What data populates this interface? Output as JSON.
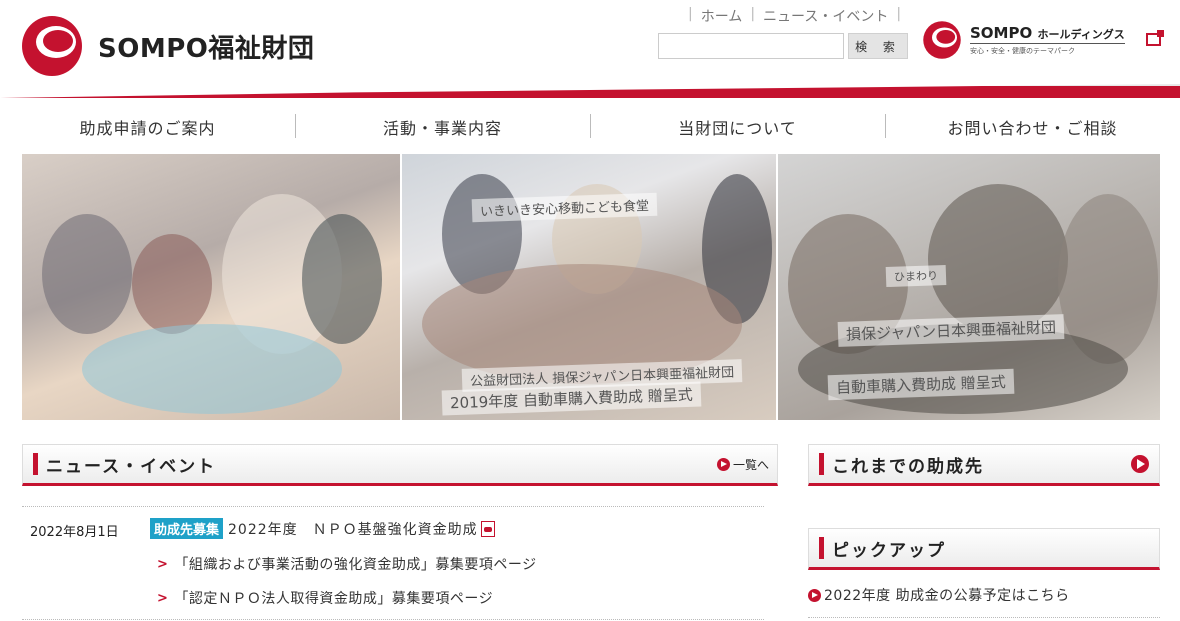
{
  "header": {
    "logo_text": "SOMPO福祉財団",
    "top_links": [
      "ホーム",
      "ニュース・イベント"
    ],
    "search_button": "検 索",
    "search_placeholder": "",
    "holdings_name": "SOMPO",
    "holdings_suffix": "ホールディングス",
    "holdings_tagline": "安心・安全・健康のテーマパーク"
  },
  "nav": {
    "items": [
      "助成申請のご案内",
      "活動・事業内容",
      "当財団について",
      "お問い合わせ・ご相談"
    ]
  },
  "hero": {
    "photo2_banner_top": "いきいき安心移動こども食堂",
    "photo2_banner_1": "公益財団法人 損保ジャパン日本興亜福祉財団",
    "photo2_banner_2": "2019年度 自動車購入費助成 贈呈式",
    "photo3_banner_1": "損保ジャパン日本興亜福祉財団",
    "photo3_banner_2": "自動車購入費助成 贈呈式",
    "photo3_sign": "ひまわり"
  },
  "news": {
    "title": "ニュース・イベント",
    "more_label": "一覧へ",
    "items": [
      {
        "date": "2022年8月1日",
        "badge": "助成先募集",
        "title": "2022年度　ＮＰＯ基盤強化資金助成",
        "links": [
          "「組織および事業活動の強化資金助成」募集要項ページ",
          "「認定ＮＰＯ法人取得資金助成」募集要項ページ"
        ]
      }
    ]
  },
  "sidebar": {
    "grantees_title": "これまでの助成先",
    "pickup_title": "ピックアップ",
    "pickup_items": [
      "2022年度 助成金の公募予定はこちら"
    ]
  },
  "colors": {
    "brand_red": "#c4122f",
    "badge_blue": "#1ea1c8"
  }
}
